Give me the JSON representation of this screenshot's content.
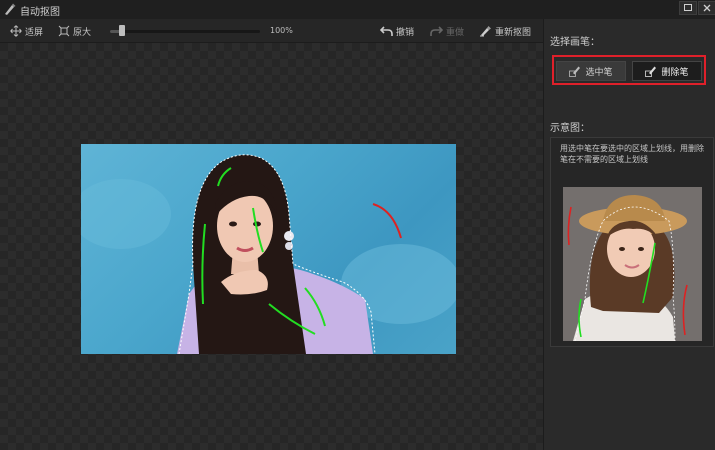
{
  "window": {
    "title": "自动抠图"
  },
  "toolbar": {
    "fit_label": "适屏",
    "original_label": "原大",
    "zoom_percent": 100,
    "zoom_text": "100%",
    "undo_label": "撤销",
    "redo_label": "重做",
    "reset_label": "重新抠图"
  },
  "panel": {
    "brush_heading": "选择画笔：",
    "select_brush_label": "选中笔",
    "delete_brush_label": "删除笔",
    "active_brush": "删除笔",
    "example_heading": "示意图：",
    "hint_text": "用选中笔在要选中的区域上划线，用删除笔在不需要的区域上划线"
  },
  "colors": {
    "highlight": "#e0202a",
    "select_stroke": "#22dd22",
    "delete_stroke": "#dd2222",
    "photo_background": "#4aa6cc"
  },
  "icons": {
    "fit": "fit-screen-icon",
    "original": "original-size-icon",
    "undo": "undo-icon",
    "redo": "redo-icon",
    "reset": "reset-brush-icon",
    "select_brush": "select-brush-icon",
    "delete_brush": "delete-brush-icon"
  }
}
